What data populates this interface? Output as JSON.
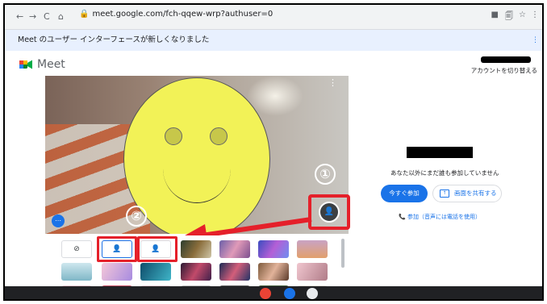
{
  "browser": {
    "back": "←",
    "forward": "→",
    "reload": "C",
    "home": "⌂",
    "url": "meet.google.com/fch-qqew-wrp?authuser=0"
  },
  "notice": {
    "text": "Meet のユーザー インターフェースが新しくなりました"
  },
  "header": {
    "app_name": "Meet",
    "account_switch": "アカウントを切り替える"
  },
  "preview": {
    "effects_button_icon": "person-background-icon",
    "annotation_1": "①",
    "annotation_2": "②"
  },
  "backgrounds": {
    "none_label": "⊘",
    "slight_blur_label": "👤",
    "blur_label": "👤"
  },
  "side": {
    "status": "あなた以外にまだ誰も参加していません",
    "join_button": "今すぐ参加",
    "share_button": "画面を共有する",
    "phone_link": "参加（音声には電話を使用）"
  },
  "colors": {
    "accent": "#1a73e8",
    "annotation_red": "#e5202a",
    "smiley": "#f2f257"
  }
}
